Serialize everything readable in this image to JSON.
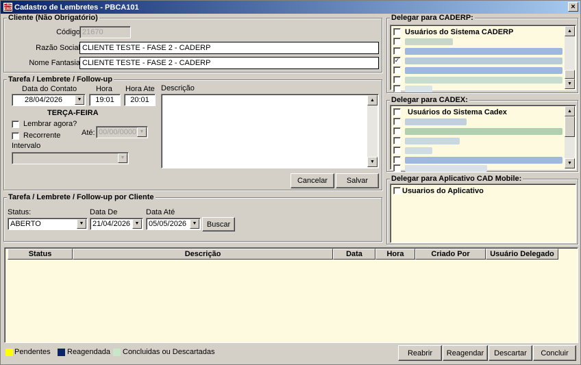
{
  "window": {
    "title": "Cadastro de Lembretes - PBCA101",
    "icon_text_top": "CAD",
    "icon_text_bottom": "ERP",
    "close_label": "×"
  },
  "cliente": {
    "title": "Cliente (Não Obrigatório)",
    "codigo_label": "Código:",
    "codigo_value": "21670",
    "razao_label": "Razão Social:",
    "razao_value": "CLIENTE TESTE - FASE 2 - CADERP",
    "fantasia_label": "Nome Fantasia:",
    "fantasia_value": "CLIENTE TESTE - FASE 2 - CADERP"
  },
  "tarefa": {
    "title": "Tarefa / Lembrete / Follow-up",
    "data_label": "Data do Contato",
    "data_value": "28/04/2026",
    "hora_label": "Hora",
    "hora_value": "19:01",
    "hora_ate_label": "Hora Ate",
    "hora_ate_value": "20:01",
    "descricao_label": "Descrição",
    "weekday": "TERÇA-FEIRA",
    "lembrar_label": "Lembrar agora?",
    "recorrente_label": "Recorrente",
    "ate_label": "Até:",
    "ate_value": "00/00/0000",
    "intervalo_label": "Intervalo",
    "cancelar": "Cancelar",
    "salvar": "Salvar"
  },
  "filtro": {
    "title": "Tarefa / Lembrete / Follow-up por Cliente",
    "status_label": "Status:",
    "status_value": "ABERTO",
    "data_de_label": "Data De",
    "data_de_value": "21/04/2026",
    "data_ate_label": "Data Até",
    "data_ate_value": "05/05/2026",
    "buscar": "Buscar"
  },
  "caderp": {
    "title": "Delegar para CADERP:",
    "header_item": "Usuários do Sistema CADERP",
    "checked_row": 3
  },
  "cadex": {
    "title": "Delegar para CADEX:",
    "header_item": "Usuários do Sistema Cadex"
  },
  "mobile": {
    "title": "Delegar para Aplicativo CAD Mobile:",
    "header_item": "Usuarios do Aplicativo"
  },
  "grid": {
    "columns": [
      "Status",
      "Descrição",
      "Data",
      "Hora",
      "Criado Por",
      "Usuário Delegado"
    ]
  },
  "legend": {
    "pendentes": "Pendentes",
    "reagendada": "Reagendada",
    "concluidas": "Concluidas ou Descartadas",
    "colors": {
      "pendentes": "#ffff00",
      "reagendada": "#0a246a",
      "concluidas": "#c8e6c8"
    }
  },
  "actions": {
    "reabrir": "Reabrir",
    "reagendar": "Reagendar",
    "descartar": "Descartar",
    "concluir": "Concluir"
  }
}
